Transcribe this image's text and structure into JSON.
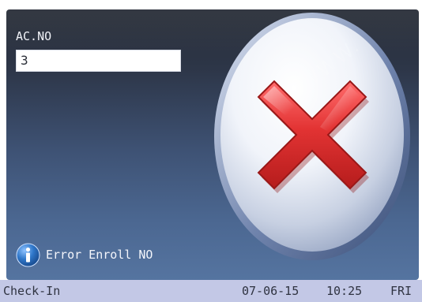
{
  "screen": {
    "acno_label": "AC.NO",
    "acno_value": "3",
    "result_icon": "error-x-icon",
    "info_icon": "info-icon",
    "message": "Error Enroll NO"
  },
  "status_bar": {
    "mode": "Check-In",
    "date": "07-06-15",
    "time": "10:25",
    "day": "FRI"
  },
  "colors": {
    "screen_top": "#272c36",
    "screen_bottom": "#5574a0",
    "status_bar": "#c3c8e6",
    "x_red": "#d62a2a",
    "info_blue": "#2f77c9"
  }
}
